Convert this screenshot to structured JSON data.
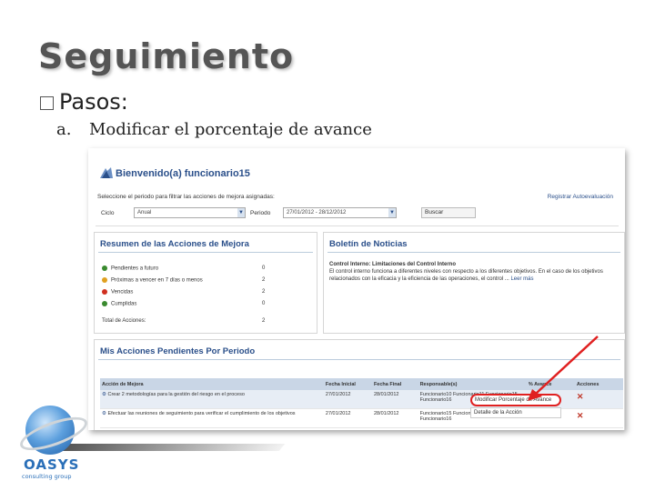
{
  "slide": {
    "title": "Seguimiento",
    "bullet1": "Pasos:",
    "bullet2_num": "a.",
    "bullet2_text": "Modificar el porcentaje de avance"
  },
  "app": {
    "welcome_title": "Bienvenido(a) funcionario15",
    "welcome_sub": "Seleccione el periodo para filtrar las acciones de mejora asignadas:",
    "register_link": "Registrar Autoevaluación",
    "ciclo_label": "Ciclo",
    "ciclo_value": "Anual",
    "periodo_label": "Periodo",
    "periodo_value": "27/01/2012 - 28/12/2012",
    "buscar_label": "Buscar"
  },
  "resumen": {
    "title": "Resumen de las Acciones de Mejora",
    "items": [
      {
        "label": "Pendientes a futuro",
        "value": "0",
        "color": "#3a8a2f"
      },
      {
        "label": "Próximas a vencer en 7 días o menos",
        "value": "2",
        "color": "#e0a020"
      },
      {
        "label": "Vencidas",
        "value": "2",
        "color": "#d03020"
      },
      {
        "label": "Cumplidas",
        "value": "0",
        "color": "#3a8a2f"
      }
    ],
    "total_label": "Total de Acciones:",
    "total_value": "2"
  },
  "boletin": {
    "title": "Boletín de Noticias",
    "heading": "Control Interno: Limitaciones del Control Interno",
    "body": "El control interno funciona a diferentes niveles con respecto a los diferentes objetivos. En el caso de los objetivos relacionados con la eficacia y la eficiencia de las operaciones, el control ...",
    "more": "Leer más"
  },
  "acciones": {
    "title": "Mis Acciones Pendientes Por Periodo",
    "columns": [
      "Acción de Mejora",
      "Fecha Inicial",
      "Fecha Final",
      "Responsable(s)",
      "% Avance",
      "Acciones"
    ],
    "rows": [
      {
        "accion": "Crear 2 metodologías para la gestión del riesgo en el proceso",
        "inicio": "27/01/2012",
        "fin": "28/01/2012",
        "resp": "Funcionario10 Funcionario11 Funcionario15 Funcionario16"
      },
      {
        "accion": "Efectuar las reuniones de seguimiento para verificar el cumplimiento de los objetivos",
        "inicio": "27/01/2012",
        "fin": "28/01/2012",
        "resp": "Funcionario15 Funcionario16 Funcionario10 Funcionario16"
      }
    ],
    "menu": [
      "Modificar Porcentaje de Avance",
      "Detalle de la Acción"
    ]
  },
  "logo": {
    "name": "OASYS",
    "tagline": "consulting group"
  }
}
